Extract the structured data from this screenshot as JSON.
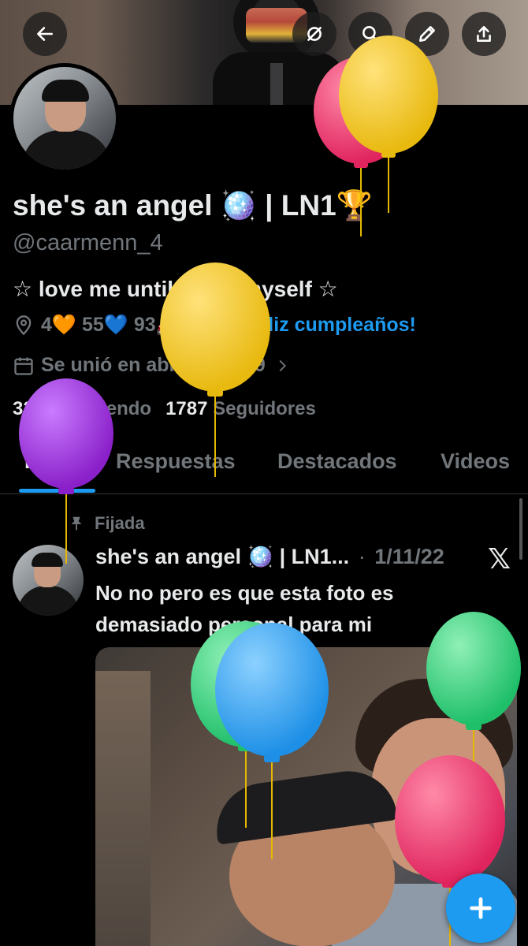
{
  "header": {
    "back_icon": "arrow-left-icon",
    "actions": [
      "no-grok-icon",
      "search-icon",
      "edit-icon",
      "share-icon"
    ]
  },
  "profile": {
    "name": "she's an angel 🪩 | LN1🏆",
    "handle": "@caarmenn_4",
    "bio": "☆ love me until I love myself ☆",
    "location": "4🧡 55💙 93🏍️",
    "birthday_link": "¡Feliz cumpleaños!",
    "joined": "Se unió en abril de 2019",
    "following_count": "3235",
    "following_label": "Siguiendo",
    "followers_count": "1787",
    "followers_label": "Seguidores"
  },
  "tabs": [
    {
      "label": "Posts",
      "active": true
    },
    {
      "label": "Respuestas",
      "active": false
    },
    {
      "label": "Destacados",
      "active": false
    },
    {
      "label": "Videos",
      "active": false
    }
  ],
  "post": {
    "pinned_label": "Fijada",
    "author": "she's an angel 🪩 | LN1...",
    "separator": "·",
    "date": "1/11/22",
    "text": "No no pero es que esta foto es demasiado personal para mi"
  },
  "colors": {
    "accent": "#1d9bf0",
    "background": "#000000",
    "text_primary": "#e7e9ea",
    "text_secondary": "#71767b"
  }
}
